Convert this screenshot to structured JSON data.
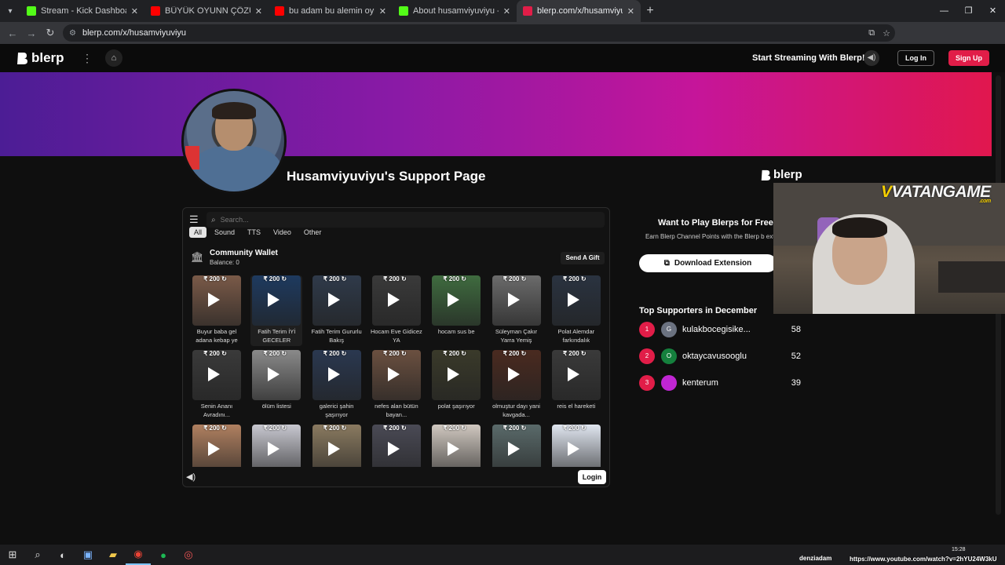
{
  "browser": {
    "tabs": [
      {
        "title": "Stream - Kick Dashboard",
        "favicon_color": "#53fc18",
        "active": false
      },
      {
        "title": "BÜYÜK OYUNN ÇÖZÜLDÜ - Yo",
        "favicon_color": "#ff0000",
        "active": false
      },
      {
        "title": "bu adam bu alemin oyuncusu",
        "favicon_color": "#ff0000",
        "active": false
      },
      {
        "title": "About husamviyuviyu - Watch",
        "favicon_color": "#53fc18",
        "active": false
      },
      {
        "title": "blerp.com/x/husamviyuviyu",
        "favicon_color": "#e11d48",
        "active": true
      }
    ],
    "url": "blerp.com/x/husamviyuviyu"
  },
  "header": {
    "logo": "blerp",
    "start_streaming": "Start Streaming With Blerp!",
    "login": "Log In",
    "signup": "Sign Up"
  },
  "profile": {
    "title": "Husamviyuviyu's Support Page"
  },
  "board": {
    "search_placeholder": "Search...",
    "filters": [
      "All",
      "Sound",
      "TTS",
      "Video",
      "Other"
    ],
    "wallet_name": "Community Wallet",
    "wallet_balance": "Balance: 0",
    "gift_button": "Send A Gift",
    "login": "Login",
    "tiles": [
      {
        "price": "200",
        "label": "Buyur baba gel adana kebap ye",
        "color": "#7a5a48"
      },
      {
        "price": "200",
        "label": "Fatih Terim İYİ GECELER",
        "color": "#1e3a5f",
        "hover": true
      },
      {
        "price": "200",
        "label": "Fatih Terim Gururlu Bakış",
        "color": "#2f3a4a"
      },
      {
        "price": "200",
        "label": "Hocam Eve Gidicez YA",
        "color": "#3a3a3a"
      },
      {
        "price": "200",
        "label": "hocam sus be",
        "color": "#3f6b3f"
      },
      {
        "price": "200",
        "label": "Süleyman Çakır Yarra Yemiş",
        "color": "#6b6b6b"
      },
      {
        "price": "200",
        "label": "Polat Alemdar farkındalık",
        "color": "#2a3340"
      },
      {
        "price": "200",
        "label": "Senin Ananı Avradını...",
        "color": "#3a3a3a"
      },
      {
        "price": "200",
        "label": "ölüm listesi",
        "color": "#8a8a8a"
      },
      {
        "price": "200",
        "label": "galerici şahin şaşırıyor",
        "color": "#2a3850"
      },
      {
        "price": "200",
        "label": "nefes alan bütün bayan...",
        "color": "#6b5040"
      },
      {
        "price": "200",
        "label": "polat şaşırıyor",
        "color": "#3a3a2a"
      },
      {
        "price": "200",
        "label": "olmuştur dayı yani kavgada...",
        "color": "#4a2a20"
      },
      {
        "price": "200",
        "label": "reis el hareketi",
        "color": "#3a3a3a"
      },
      {
        "price": "200",
        "label": "",
        "color": "#b08060"
      },
      {
        "price": "200",
        "label": "",
        "color": "#c8c8d0"
      },
      {
        "price": "200",
        "label": "",
        "color": "#8a7a60"
      },
      {
        "price": "200",
        "label": "",
        "color": "#4a4a55"
      },
      {
        "price": "200",
        "label": "",
        "color": "#d0c8c0"
      },
      {
        "price": "200",
        "label": "",
        "color": "#5a6a6a"
      },
      {
        "price": "200",
        "label": "",
        "color": "#e0e6f0"
      }
    ]
  },
  "sidebar": {
    "logo": "blerp",
    "want_play": "Want to Play Blerps for Free",
    "earn_text": "Earn Blerp Channel Points with the Blerp b extension",
    "download": "Download Extension",
    "supporters_title": "Top Supporters in December",
    "supporters": [
      {
        "rank": "1",
        "avatar": "G",
        "avatar_color": "#6b7280",
        "name": "kulakbocegisike...",
        "count": "58"
      },
      {
        "rank": "2",
        "avatar": "O",
        "avatar_color": "#15803d",
        "name": "oktaycavusooglu",
        "count": "52"
      },
      {
        "rank": "3",
        "avatar": "",
        "avatar_color": "#c026d3",
        "name": "kenterum",
        "count": "39"
      }
    ]
  },
  "overlay": {
    "brand_v": "V",
    "brand_rest": "VATANGAME",
    "brand_com": ".com",
    "streamer": "denziadam",
    "youtube_url": "https://www.youtube.com/watch?v=2hYU24W3kU",
    "time": "15:28"
  }
}
